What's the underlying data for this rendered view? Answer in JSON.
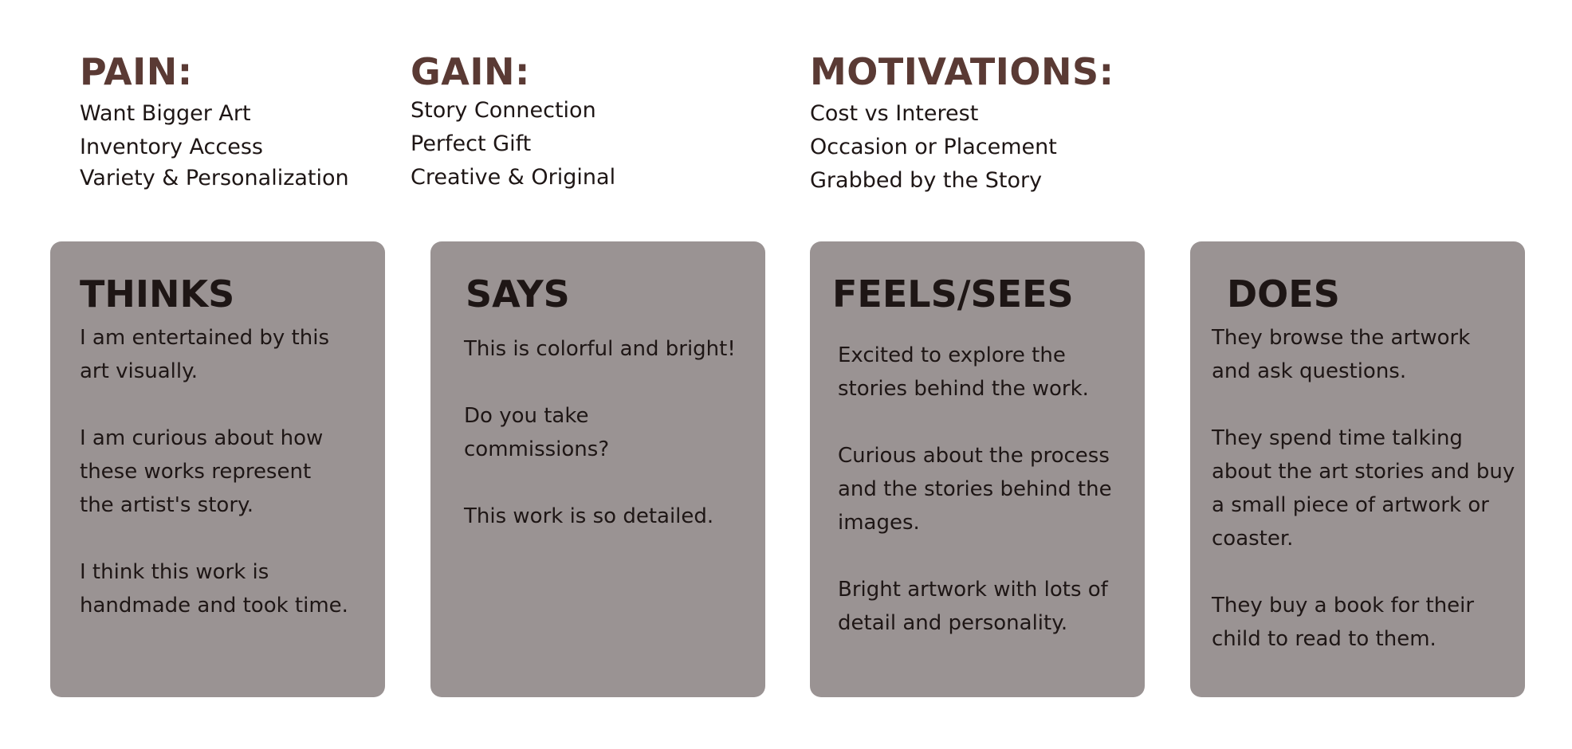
{
  "pain": {
    "title": "PAIN:",
    "items": [
      "Want Bigger Art",
      "Inventory Access",
      "Variety & Personalization"
    ]
  },
  "gain": {
    "title": "GAIN:",
    "items": [
      "Story Connection",
      "Perfect Gift",
      "Creative & Original"
    ]
  },
  "motivations": {
    "title": "MOTIVATIONS:",
    "items": [
      "Cost vs Interest",
      "Occasion or Placement",
      "Grabbed by the Story"
    ]
  },
  "cards": {
    "thinks": {
      "title": "THINKS",
      "lines": [
        "I am entertained by this",
        "art visually.",
        "I am curious about how",
        "these works represent",
        "the artist's story.",
        "I think this work is",
        "handmade and took time."
      ]
    },
    "says": {
      "title": "SAYS",
      "lines": [
        "This is colorful and bright!",
        "Do you take",
        "commissions?",
        "This work is so detailed."
      ]
    },
    "feels": {
      "title": "FEELS/SEES",
      "lines": [
        "Excited to explore the",
        "stories behind the work.",
        "Curious about the process",
        "and the stories behind the",
        "images.",
        "Bright artwork with lots of",
        "detail and personality."
      ]
    },
    "does": {
      "title": "DOES",
      "lines": [
        "They browse the artwork",
        "and ask questions.",
        "They spend time talking",
        "about the art stories and buy",
        "a small piece of artwork or",
        "coaster.",
        "They buy a book for their",
        "child to read to them."
      ]
    }
  },
  "colors": {
    "heading": "#5a3a34",
    "card_background": "#9a9393",
    "text": "#1e1615",
    "background": "#ffffff"
  }
}
